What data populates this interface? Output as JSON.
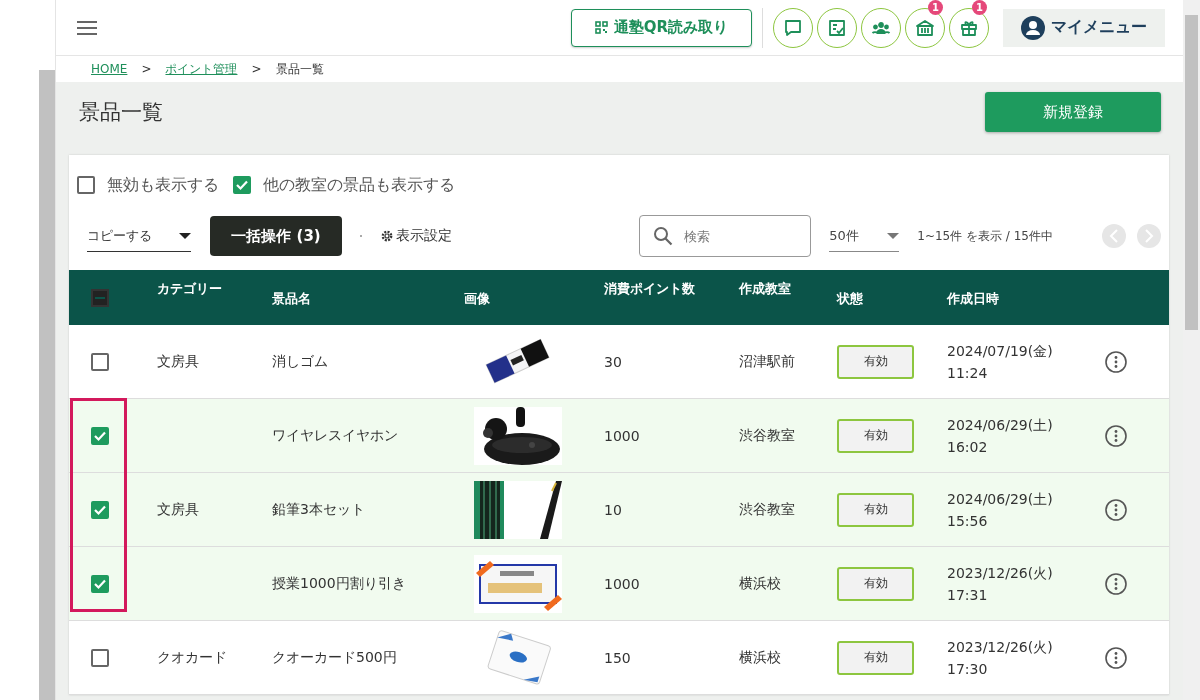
{
  "header": {
    "qr_button": "通塾QR読み取り",
    "icon_buttons": [
      {
        "kind": "chat"
      },
      {
        "kind": "checklist"
      },
      {
        "kind": "group"
      },
      {
        "kind": "shop",
        "badge": "1"
      },
      {
        "kind": "gift",
        "badge": "1"
      }
    ],
    "my_menu": "マイメニュー"
  },
  "breadcrumb": [
    {
      "kind": "link",
      "text": "HOME"
    },
    {
      "kind": "separator",
      "text": ">"
    },
    {
      "kind": "link",
      "text": "ポイント管理"
    },
    {
      "kind": "separator",
      "text": ">"
    },
    {
      "kind": "current",
      "text": "景品一覧"
    }
  ],
  "page_title": "景品一覧",
  "new_button": "新規登録",
  "filters": [
    {
      "label": "無効も表示する",
      "checked": false
    },
    {
      "label": "他の教室の景品も表示する",
      "checked": true
    }
  ],
  "toolbar": {
    "copy_select": "コピーする",
    "bulk_button": "一括操作 (3)",
    "display_settings": "表示設定",
    "search": {
      "placeholder": "検索"
    },
    "per_page": "50件",
    "range": "1~15件 を表示 / 15件中",
    "prev_disabled": true,
    "next_disabled": true
  },
  "table": {
    "header_checkbox": {
      "indeterminate": true
    },
    "columns": [
      "カテゴリー",
      "景品名",
      "画像",
      "消費ポイント数",
      "作成教室",
      "状態",
      "作成日時"
    ],
    "rows": [
      {
        "selected": false,
        "category": "文房具",
        "name": "消しゴム",
        "points": "30",
        "school": "沼津駅前",
        "status": "有効",
        "date": "2024/07/19(金)",
        "time": "11:24"
      },
      {
        "selected": true,
        "name": "ワイヤレスイヤホン",
        "points": "1000",
        "school": "渋谷教室",
        "status": "有効",
        "date": "2024/06/29(土)",
        "time": "16:02"
      },
      {
        "selected": true,
        "category": "文房具",
        "name": "鉛筆3本セット",
        "points": "10",
        "school": "渋谷教室",
        "status": "有効",
        "date": "2024/06/29(土)",
        "time": "15:56"
      },
      {
        "selected": true,
        "name": "授業1000円割り引き",
        "points": "1000",
        "school": "横浜校",
        "status": "有効",
        "date": "2023/12/26(火)",
        "time": "17:31"
      },
      {
        "selected": false,
        "category": "クオカード",
        "name": "クオーカード500円",
        "points": "150",
        "school": "横浜校",
        "status": "有効",
        "date": "2023/12/26(火)",
        "time": "17:30"
      }
    ]
  }
}
